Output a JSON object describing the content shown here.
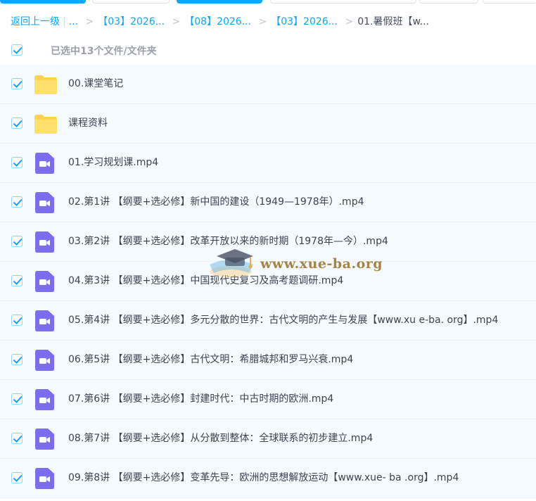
{
  "breadcrumb": {
    "back": "返回上一级",
    "ellipsis": "...",
    "items": [
      "【03】2026...",
      "【08】2026...",
      "【03】2026..."
    ],
    "current": "01.暑假班【w..."
  },
  "selection": {
    "text": "已选中13个文件/文件夹"
  },
  "files": [
    {
      "name": "00.课堂笔记",
      "type": "folder"
    },
    {
      "name": "课程资料",
      "type": "folder"
    },
    {
      "name": "01.学习规划课.mp4",
      "type": "video"
    },
    {
      "name": "02.第1讲 【纲要+选必修】新中国的建设（1949—1978年）.mp4",
      "type": "video"
    },
    {
      "name": "03.第2讲 【纲要+选必修】改革开放以来的新时期（1978年—今）.mp4",
      "type": "video"
    },
    {
      "name": "04.第3讲 【纲要+选必修】中国现代史复习及高考题调研.mp4",
      "type": "video"
    },
    {
      "name": "05.第4讲 【纲要+选必修】多元分散的世界：古代文明的产生与发展【www.xu e-ba. org】.mp4",
      "type": "video"
    },
    {
      "name": "06.第5讲 【纲要+选必修】古代文明：希腊城邦和罗马兴衰.mp4",
      "type": "video"
    },
    {
      "name": "07.第6讲 【纲要+选必修】封建时代：中古时期的欧洲.mp4",
      "type": "video"
    },
    {
      "name": "08.第7讲 【纲要+选必修】从分散到整体：全球联系的初步建立.mp4",
      "type": "video"
    },
    {
      "name": "09.第8讲 【纲要+选必修】变革先导：欧洲的思想解放运动【www.xue- ba .org】.mp4",
      "type": "video"
    }
  ],
  "watermark": {
    "text": "www.xue-ba.org"
  },
  "colors": {
    "accent": "#06a7ff",
    "video_icon": "#7c6cf0",
    "folder_icon": "#ffd34f",
    "row_bg": "#f5faff"
  }
}
